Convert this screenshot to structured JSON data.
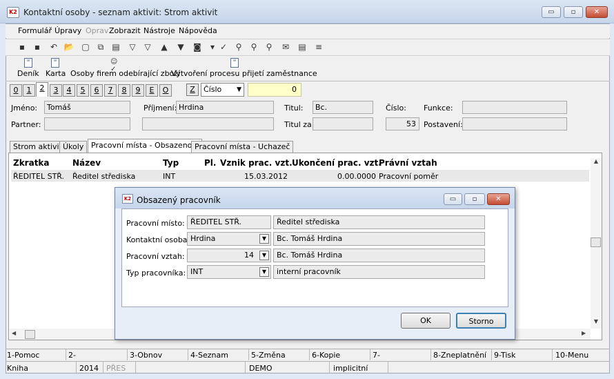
{
  "window": {
    "title": "Kontaktní osoby - seznam aktivit: Strom aktivit",
    "icon_text": "K2",
    "min": "▭",
    "max": "▫",
    "close": "✕"
  },
  "menu": [
    "Formulář",
    "Úpravy",
    "Oprav",
    "Zobrazit",
    "Nástroje",
    "Nápověda"
  ],
  "toolbar_icons": [
    "save-icon",
    "save-disabled-icon",
    "undo-icon",
    "open-folder-icon",
    "new-document-icon",
    "copy-icon",
    "book-icon",
    "filter-icon",
    "filter-edit-icon",
    "arrow-up-icon",
    "arrow-down-icon",
    "camera-icon",
    "dropdown-arrow-icon",
    "green-check-icon",
    "binoculars-icon",
    "binoculars-next-icon",
    "binoculars-prev-icon",
    "envelope-icon",
    "notes-icon",
    "menu-lines-icon"
  ],
  "toolbar_glyphs": [
    "▪",
    "▪",
    "↶",
    "📂",
    "▢",
    "⧉",
    "▤",
    "▽",
    "▽",
    "▲",
    "▼",
    "◙",
    "▾",
    "✓",
    "⚲",
    "⚲",
    "⚲",
    "✉",
    "▤",
    "≡"
  ],
  "function_buttons": [
    "Deník",
    "Karta",
    "Osoby firem odebírající zboží",
    "Vytvoření procesu přijetí zaměstnance"
  ],
  "book_tabs": [
    "0",
    "1",
    "2",
    "3",
    "4",
    "5",
    "6",
    "7",
    "8",
    "9",
    "E",
    "O"
  ],
  "sort": {
    "key_button": "Z",
    "selected": "Číslo",
    "value": "0"
  },
  "form": {
    "jmeno_label": "Jméno:",
    "jmeno": "Tomáš",
    "prijmeni_label": "Příjmení:",
    "prijmeni": "Hrdina",
    "titul_label": "Titul:",
    "titul": "Bc.",
    "cislo_label": "Číslo:",
    "funkce_label": "Funkce:",
    "funkce": "",
    "partner_label": "Partner:",
    "partner": "",
    "partner2": "",
    "titul_za_label": "Titul za:",
    "titul_za": "",
    "cislo": "53",
    "postaveni_label": "Postavení:",
    "postaveni": ""
  },
  "page_tabs": [
    "Strom aktivit",
    "Úkoly",
    "Pracovní místa - Obsazenost",
    "Pracovní místa - Uchazeč"
  ],
  "grid": {
    "headers": [
      "Zkratka",
      "Název",
      "Typ",
      "Pl.",
      "Vznik prac. vzt.",
      "Ukončení prac. vzt.",
      "Právní vztah"
    ],
    "rows": [
      [
        "ŘEDITEL STŘ.",
        "Ředitel střediska",
        "INT",
        "",
        "15.03.2012",
        "0.00.0000",
        "Pracovní poměr"
      ]
    ]
  },
  "dialog": {
    "title": "Obsazený pracovník",
    "pracovni_misto_label": "Pracovní místo:",
    "pracovni_misto": "ŘEDITEL STŘ.",
    "pracovni_misto_nazev": "Ředitel střediska",
    "kontaktni_osoba_label": "Kontaktní osoba:",
    "kontaktni_osoba": "Hrdina",
    "kontaktni_osoba_jmeno": "Bc. Tomáš Hrdina",
    "pracovni_vztah_label": "Pracovní vztah:",
    "pracovni_vztah": "14",
    "pracovni_vztah_jmeno": "Bc. Tomáš Hrdina",
    "typ_label": "Typ pracovníka:",
    "typ": "INT",
    "typ_nazev": "interní pracovník",
    "ok": "OK",
    "storno": "Storno"
  },
  "fkeys": [
    "1-Pomoc",
    "2-",
    "3-Obnov",
    "4-Seznam",
    "5-Změna",
    "6-Kopie",
    "7-",
    "8-Zneplatnění",
    "9-Tisk",
    "10-Menu"
  ],
  "status": [
    "Kniha",
    "2014",
    "PŘES",
    "DEMO",
    "implicitní"
  ]
}
